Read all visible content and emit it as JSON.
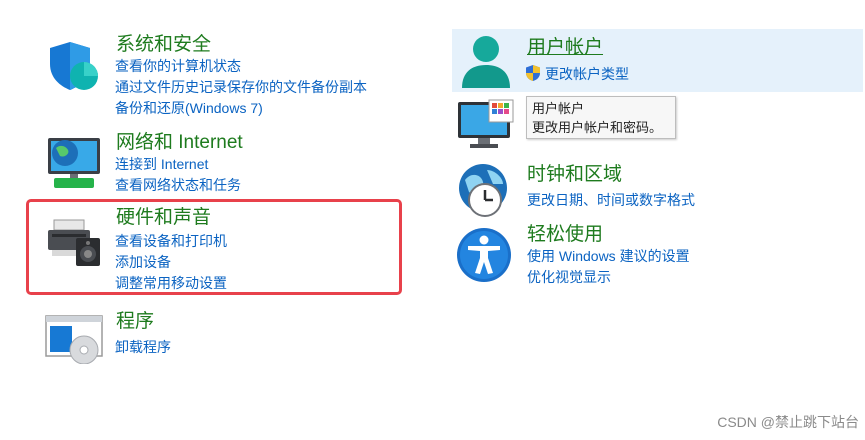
{
  "categories": {
    "system": {
      "title": "系统和安全",
      "icon": "shield-icon",
      "links": [
        "查看你的计算机状态",
        "通过文件历史记录保存你的文件备份副本",
        "备份和还原(Windows 7)"
      ]
    },
    "network": {
      "title": "网络和 Internet",
      "icon": "network-monitor-icon",
      "links": [
        "连接到 Internet",
        "查看网络状态和任务"
      ]
    },
    "hardware": {
      "title": "硬件和声音",
      "icon": "printer-speaker-icon",
      "links": [
        "查看设备和打印机",
        "添加设备",
        "调整常用移动设置"
      ]
    },
    "programs": {
      "title": "程序",
      "icon": "programs-disc-icon",
      "links": [
        "卸载程序"
      ]
    },
    "user_accounts": {
      "title": "用户帐户",
      "icon": "user-icon",
      "links": [
        "更改帐户类型"
      ]
    },
    "appearance": {
      "icon": "display-monitor-icon"
    },
    "clock": {
      "title": "时钟和区域",
      "icon": "globe-clock-icon",
      "links": [
        "更改日期、时间或数字格式"
      ]
    },
    "ease": {
      "title": "轻松使用",
      "icon": "accessibility-icon",
      "links": [
        "使用 Windows 建议的设置",
        "优化视觉显示"
      ]
    }
  },
  "tooltip": {
    "title": "用户帐户",
    "description": "更改用户帐户和密码。"
  },
  "watermark": "CSDN @禁止跳下站台",
  "colors": {
    "title_green": "#1e7b1e",
    "link_blue": "#0b63c2",
    "highlight": "#e5f1fb",
    "red_annotation": "#e8414b"
  }
}
